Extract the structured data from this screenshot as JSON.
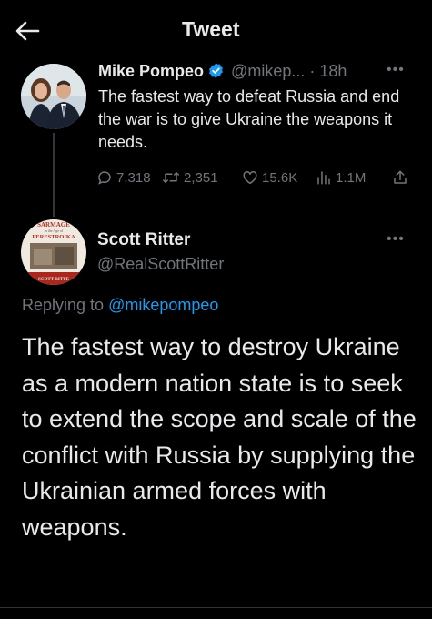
{
  "header": {
    "title": "Tweet"
  },
  "parent_tweet": {
    "author_name": "Mike Pompeo",
    "handle": "@mikep...",
    "separator": "·",
    "time": "18h",
    "text": "The fastest way to defeat Russia and end the war is to give Ukraine the weapons it needs.",
    "stats": {
      "replies": "7,318",
      "retweets": "2,351",
      "likes": "15.6K",
      "views": "1.1M"
    }
  },
  "main_tweet": {
    "author_name": "Scott Ritter",
    "handle": "@RealScottRitter",
    "replying_prefix": "Replying to",
    "replying_to": "@mikepompeo",
    "text": "The fastest way to destroy Ukraine as a modern nation state is to seek to extend the scope and scale of the conflict with Russia by supplying the Ukrainian armed forces with weapons.",
    "avatar_text": {
      "top": "SARMAGE",
      "sub": "in the Age of",
      "title": "PERESTROIKA",
      "bottom": "SCOTT RITTE"
    }
  },
  "colors": {
    "background": "#000000",
    "text": "#e7e9ea",
    "muted": "#71767b",
    "accent": "#1d9bf0"
  },
  "icons": [
    "back-arrow-icon",
    "verified-badge-icon",
    "more-icon",
    "reply-icon",
    "retweet-icon",
    "like-icon",
    "views-icon",
    "share-icon"
  ]
}
